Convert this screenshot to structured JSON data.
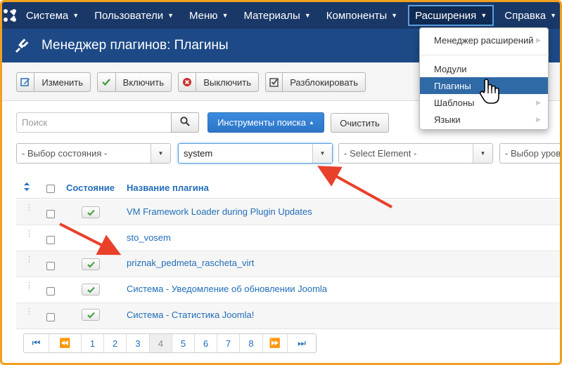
{
  "topnav": {
    "logo_icon": "joomla-logo-icon",
    "items": [
      {
        "label": "Система"
      },
      {
        "label": "Пользователи"
      },
      {
        "label": "Меню"
      },
      {
        "label": "Материалы"
      },
      {
        "label": "Компоненты"
      },
      {
        "label": "Расширения"
      },
      {
        "label": "Справка"
      }
    ]
  },
  "header": {
    "title": "Менеджер плагинов: Плагины",
    "icon": "plug-icon"
  },
  "toolbar": {
    "edit_label": "Изменить",
    "enable_label": "Включить",
    "disable_label": "Выключить",
    "unlock_label": "Разблокировать"
  },
  "search": {
    "placeholder": "Поиск",
    "tools_label": "Инструменты поиска",
    "clear_label": "Очистить"
  },
  "filters": {
    "state": "- Выбор состояния -",
    "folder": "system",
    "element": "- Select Element -",
    "level": "- Выбор уров"
  },
  "table": {
    "col_state": "Состояние",
    "col_name": "Название плагина",
    "rows": [
      {
        "name": "VM Framework Loader during Plugin Updates"
      },
      {
        "name": "sto_vosem"
      },
      {
        "name": "priznak_pedmeta_rascheta_virt"
      },
      {
        "name": "Система - Уведомление об обновлении Joomla"
      },
      {
        "name": "Система - Статистика Joomla!"
      }
    ]
  },
  "pagination": {
    "pages": [
      "1",
      "2",
      "3",
      "4",
      "5",
      "6",
      "7",
      "8"
    ],
    "current": "4"
  },
  "extensions_menu": {
    "items": [
      {
        "label": "Менеджер расширений"
      },
      {
        "label": "Модули"
      },
      {
        "label": "Плагины"
      },
      {
        "label": "Шаблоны"
      },
      {
        "label": "Языки"
      }
    ]
  },
  "colors": {
    "nav_bg": "#1a3867",
    "header_bg": "#1d4a86",
    "link": "#226eb8",
    "accent": "#2f6aa6",
    "arrow": "#e8402a",
    "frame": "#f0a020"
  }
}
